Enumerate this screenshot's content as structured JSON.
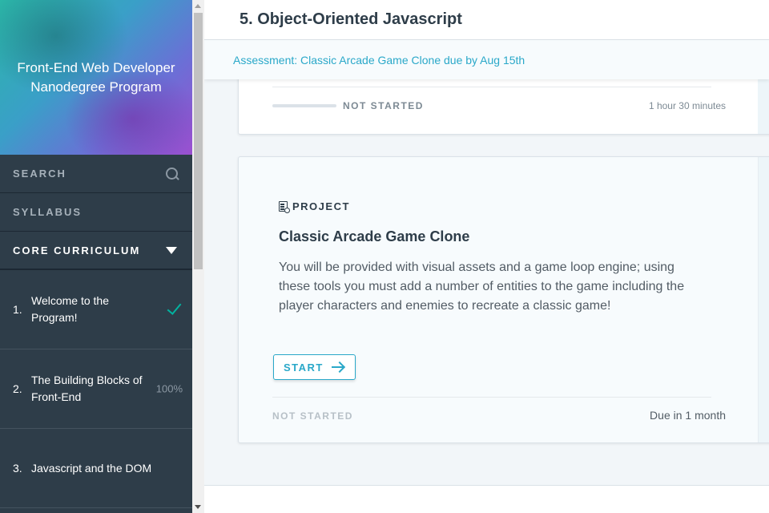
{
  "sidebar": {
    "program_title": "Front-End Web Developer Nanodegree Program",
    "search_label": "SEARCH",
    "syllabus_label": "SYLLABUS",
    "core_label": "CORE CURRICULUM",
    "lessons": [
      {
        "number": "1.",
        "title": "Welcome to the Program!",
        "status": "",
        "completed": true
      },
      {
        "number": "2.",
        "title": "The Building Blocks of Front-End",
        "status": "100%",
        "completed": false
      },
      {
        "number": "3.",
        "title": "Javascript and the DOM",
        "status": "",
        "completed": false
      }
    ]
  },
  "header": {
    "title": "5. Object-Oriented Javascript",
    "assessment_link": "Assessment: Classic Arcade Game Clone due by Aug 15th"
  },
  "cards": {
    "previous": {
      "status": "NOT STARTED",
      "duration": "1 hour 30 minutes",
      "progress": 0
    },
    "project": {
      "kind": "PROJECT",
      "title": "Classic Arcade Game Clone",
      "description": "You will be provided with visual assets and a game loop engine; using these tools you must add a number of entities to the game including the player characters and enemies to recreate a classic game!",
      "start_label": "START",
      "status": "NOT STARTED",
      "due": "Due in 1 month"
    }
  },
  "colors": {
    "accent": "#2aa8c9",
    "sidebar_bg": "#2e3d49",
    "check": "#02b3a0"
  }
}
